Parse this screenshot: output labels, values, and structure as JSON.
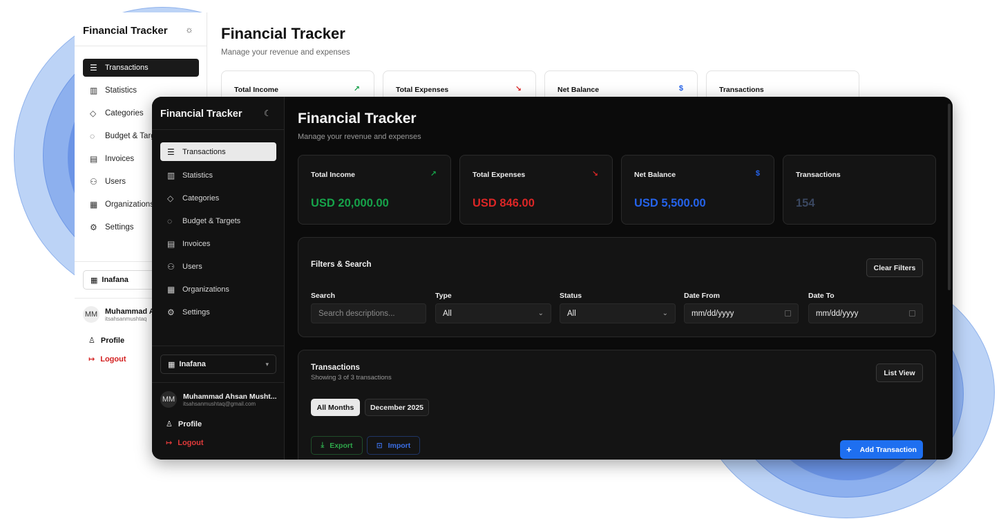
{
  "colors": {
    "income": "#16a34a",
    "expense": "#dc2626",
    "balance": "#2563eb",
    "transactions_count": "#3a4760",
    "accent": "#1e6ff0",
    "logout": "#e03a3a"
  },
  "light_app": {
    "brand": "Financial Tracker",
    "theme_icon": "sun-icon",
    "title": "Financial Tracker",
    "subtitle": "Manage your revenue and expenses",
    "nav": [
      {
        "label": "Transactions",
        "icon": "list-icon"
      },
      {
        "label": "Statistics",
        "icon": "bar-chart-icon"
      },
      {
        "label": "Categories",
        "icon": "tag-icon"
      },
      {
        "label": "Budget & Targ",
        "icon": "piggy-bank-icon"
      },
      {
        "label": "Invoices",
        "icon": "document-icon"
      },
      {
        "label": "Users",
        "icon": "users-icon"
      },
      {
        "label": "Organizations",
        "icon": "building-icon"
      },
      {
        "label": "Settings",
        "icon": "gear-icon"
      }
    ],
    "org": "Inafana",
    "user_initials": "MM",
    "user_name": "Muhammad A",
    "user_email": "itsahsanmushtaq",
    "profile": "Profile",
    "logout": "Logout",
    "cards": [
      {
        "label": "Total Income",
        "icon": "↗"
      },
      {
        "label": "Total Expenses",
        "icon": "↘"
      },
      {
        "label": "Net Balance",
        "icon": "$"
      },
      {
        "label": "Transactions",
        "icon": ""
      }
    ]
  },
  "dark_app": {
    "brand": "Financial Tracker",
    "theme_icon": "moon-icon",
    "title": "Financial Tracker",
    "subtitle": "Manage your revenue and expenses",
    "nav": [
      {
        "label": "Transactions",
        "icon": "list-icon"
      },
      {
        "label": "Statistics",
        "icon": "bar-chart-icon"
      },
      {
        "label": "Categories",
        "icon": "tag-icon"
      },
      {
        "label": "Budget & Targets",
        "icon": "piggy-bank-icon"
      },
      {
        "label": "Invoices",
        "icon": "document-icon"
      },
      {
        "label": "Users",
        "icon": "users-icon"
      },
      {
        "label": "Organizations",
        "icon": "building-icon"
      },
      {
        "label": "Settings",
        "icon": "gear-icon"
      }
    ],
    "org": "Inafana",
    "user_initials": "MM",
    "user_name": "Muhammad Ahsan Musht...",
    "user_email": "itsahsanmushtaq@gmail.com",
    "profile": "Profile",
    "logout": "Logout",
    "cards": [
      {
        "label": "Total Income",
        "icon": "↗",
        "value": "USD 20,000.00"
      },
      {
        "label": "Total Expenses",
        "icon": "↘",
        "value": "USD 846.00"
      },
      {
        "label": "Net Balance",
        "icon": "$",
        "value": "USD 5,500.00"
      },
      {
        "label": "Transactions",
        "icon": "",
        "value": "154"
      }
    ],
    "filters": {
      "title": "Filters & Search",
      "clear_label": "Clear Filters",
      "search_label": "Search",
      "search_placeholder": "Search descriptions...",
      "type_label": "Type",
      "type_value": "All",
      "status_label": "Status",
      "status_value": "All",
      "date_from_label": "Date From",
      "date_from_value": "mm/dd/yyyy",
      "date_to_label": "Date To",
      "date_to_value": "mm/dd/yyyy"
    },
    "transactions": {
      "title": "Transactions",
      "subtitle": "Showing 3 of 3 transactions",
      "view_label": "List View",
      "tabs": [
        "All Months",
        "December 2025"
      ],
      "export_label": "Export",
      "import_label": "Import",
      "add_label": "Add Transaction"
    }
  }
}
